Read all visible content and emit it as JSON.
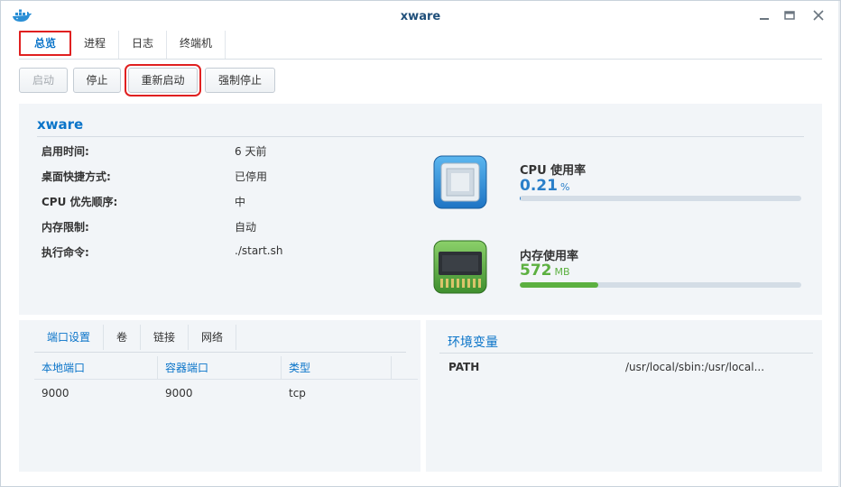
{
  "window": {
    "title": "xware"
  },
  "tabs": [
    {
      "label": "总览"
    },
    {
      "label": "进程"
    },
    {
      "label": "日志"
    },
    {
      "label": "终端机"
    }
  ],
  "toolbar": {
    "start_label": "启动",
    "stop_label": "停止",
    "restart_label": "重新启动",
    "force_stop_label": "强制停止"
  },
  "overview": {
    "container_name": "xware",
    "properties": [
      {
        "label": "启用时间:",
        "value": "6 天前"
      },
      {
        "label": "桌面快捷方式:",
        "value": "已停用"
      },
      {
        "label": "CPU 优先顺序:",
        "value": "中"
      },
      {
        "label": "内存限制:",
        "value": "自动"
      },
      {
        "label": "执行命令:",
        "value": "./start.sh"
      }
    ],
    "cpu": {
      "title": "CPU 使用率",
      "value": "0.21",
      "unit": "%",
      "fraction": 0.0021,
      "color": "#2a7fc9"
    },
    "memory": {
      "title": "内存使用率",
      "value": "572",
      "unit": "MB",
      "fraction": 0.28,
      "color": "#5cb040"
    }
  },
  "ports": {
    "subtabs": [
      {
        "label": "端口设置"
      },
      {
        "label": "卷"
      },
      {
        "label": "链接"
      },
      {
        "label": "网络"
      }
    ],
    "columns": [
      "本地端口",
      "容器端口",
      "类型"
    ],
    "rows": [
      [
        "9000",
        "9000",
        "tcp"
      ]
    ]
  },
  "env": {
    "title": "环境变量",
    "key": "PATH",
    "value": "/usr/local/sbin:/usr/local..."
  }
}
